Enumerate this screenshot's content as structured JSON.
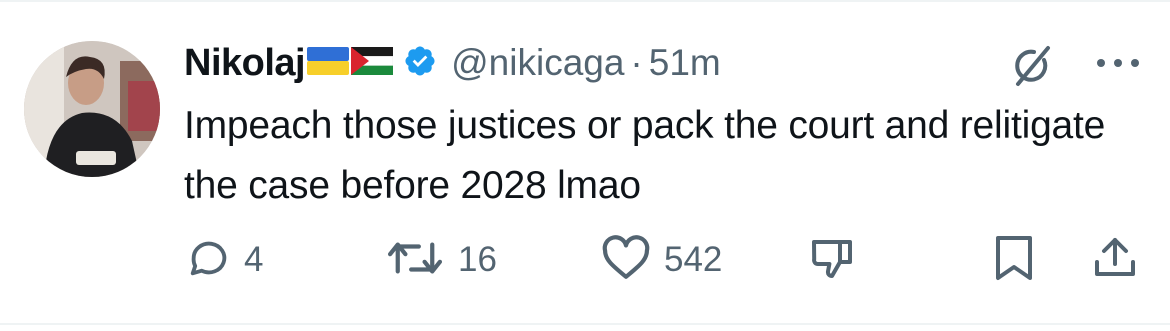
{
  "tweet": {
    "author_name": "Nikolaj",
    "flags": [
      "ukraine-flag",
      "palestine-flag"
    ],
    "verified": true,
    "handle": "@nikicaga",
    "separator": "·",
    "time": "51m",
    "text": "Impeach those justices or pack the court and relitigate the case before 2028 lmao"
  },
  "actions": {
    "replies": "4",
    "reposts": "16",
    "likes": "542"
  },
  "colors": {
    "text": "#0f1419",
    "muted": "#536471",
    "verified": "#1d9bf0",
    "divider": "#eff3f4"
  },
  "icons": [
    "grok-icon",
    "more-icon",
    "reply-icon",
    "repost-icon",
    "like-icon",
    "dislike-icon",
    "bookmark-icon",
    "share-icon"
  ]
}
